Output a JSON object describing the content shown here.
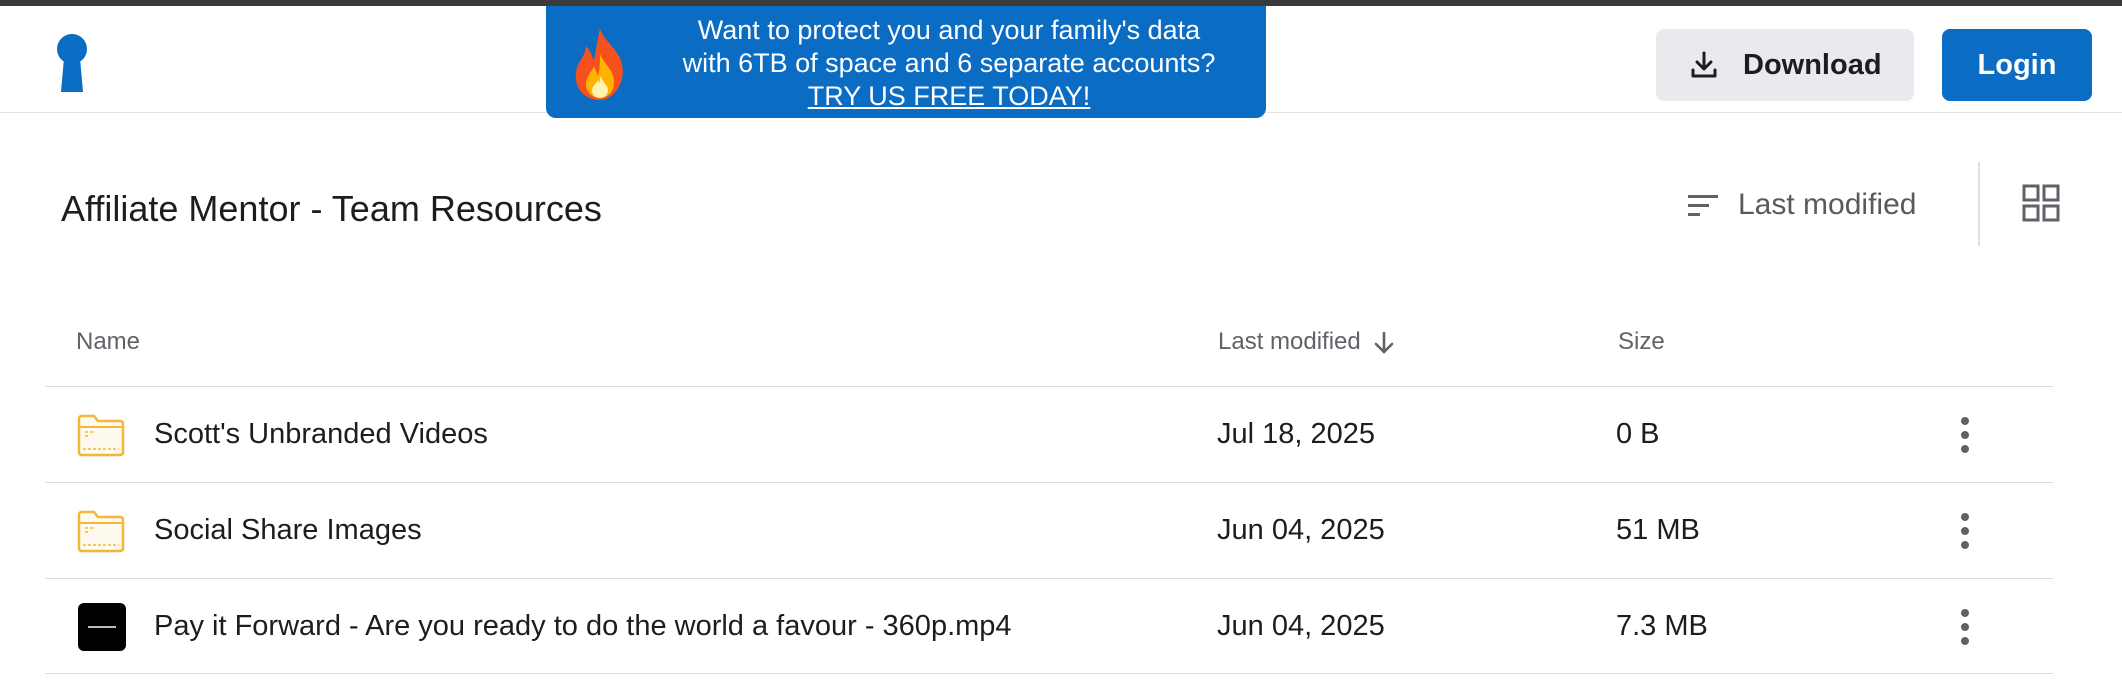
{
  "header": {
    "logo_icon": "keyhole-logo-icon",
    "promo": {
      "icon": "fire-emoji-icon",
      "line1": "Want to protect you and your family's data",
      "line2": "with 6TB of space and 6 separate accounts?",
      "cta": "TRY US FREE TODAY!"
    },
    "download_label": "Download",
    "download_icon": "download-icon",
    "login_label": "Login"
  },
  "page": {
    "title": "Affiliate Mentor - Team Resources",
    "sort_label": "Last modified",
    "sort_icon": "sort-lines-icon",
    "view_icon": "grid-view-icon"
  },
  "table": {
    "columns": {
      "name": "Name",
      "modified": "Last modified",
      "size": "Size"
    },
    "sort_direction_icon": "arrow-down-icon",
    "rows": [
      {
        "type": "folder",
        "name": "Scott's Unbranded Videos",
        "modified": "Jul 18, 2025",
        "size": "0 B"
      },
      {
        "type": "folder",
        "name": "Social Share Images",
        "modified": "Jun 04, 2025",
        "size": "51 MB"
      },
      {
        "type": "video",
        "name": "Pay it Forward - Are you ready to do the world a favour - 360p.mp4",
        "modified": "Jun 04, 2025",
        "size": "7.3 MB"
      }
    ]
  },
  "colors": {
    "brand_blue": "#0a6cc2",
    "folder_orange": "#f5b63a",
    "button_gray": "#e8eaed"
  }
}
